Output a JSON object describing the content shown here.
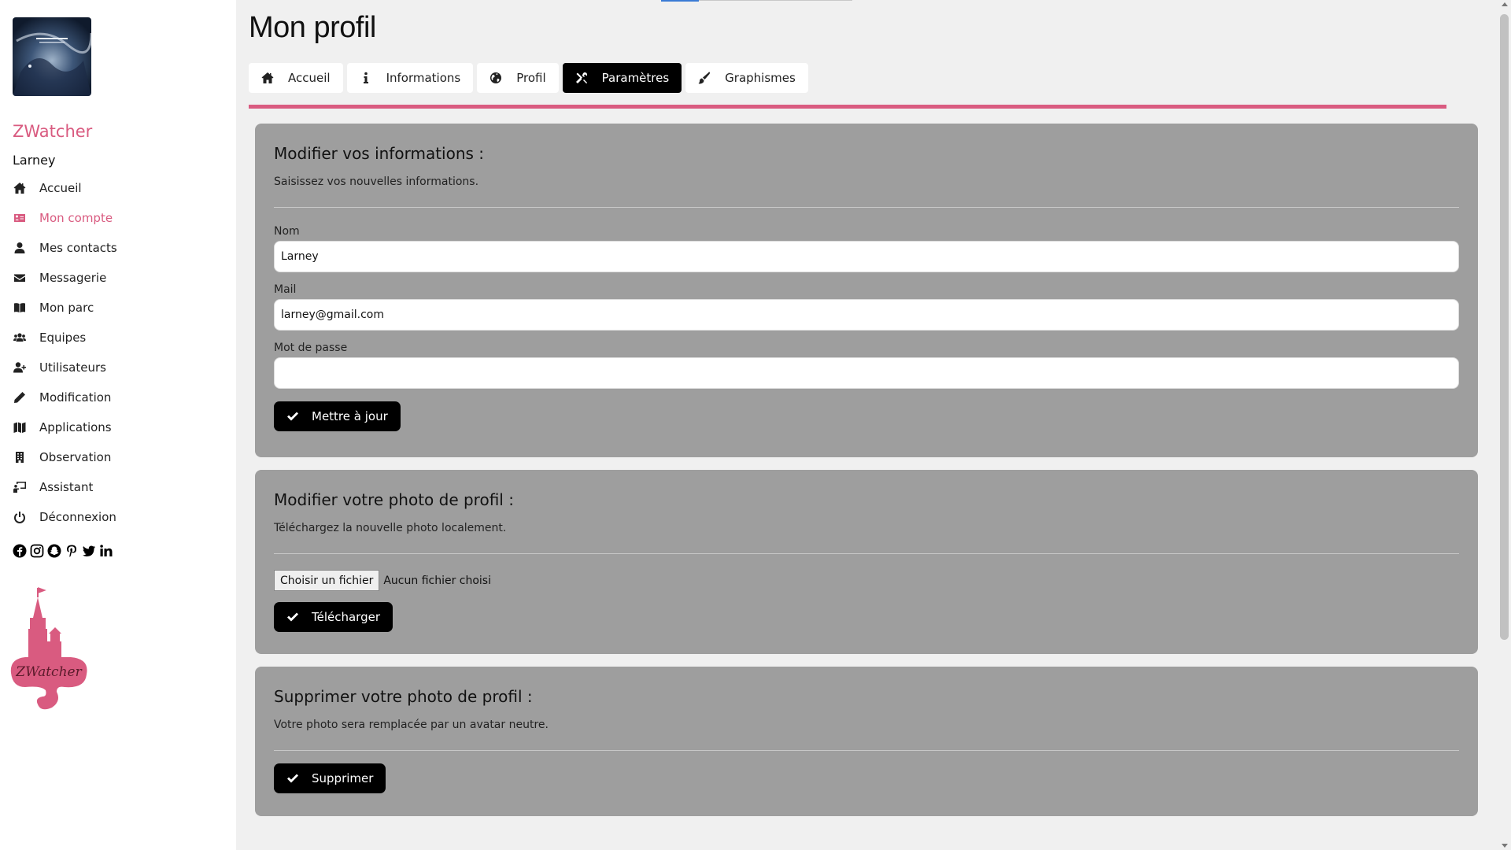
{
  "sidebar": {
    "brand": "ZWatcher",
    "username": "Larney",
    "items": [
      {
        "label": "Accueil",
        "icon": "home-icon"
      },
      {
        "label": "Mon compte",
        "icon": "id-card-icon",
        "active": true
      },
      {
        "label": "Mes contacts",
        "icon": "user-icon"
      },
      {
        "label": "Messagerie",
        "icon": "envelope-icon"
      },
      {
        "label": "Mon parc",
        "icon": "book-icon"
      },
      {
        "label": "Equipes",
        "icon": "users-icon"
      },
      {
        "label": "Utilisateurs",
        "icon": "user-plus-icon"
      },
      {
        "label": "Modification",
        "icon": "pencil-icon"
      },
      {
        "label": "Applications",
        "icon": "map-icon"
      },
      {
        "label": "Observation",
        "icon": "building-icon"
      },
      {
        "label": "Assistant",
        "icon": "chalkboard-user-icon"
      },
      {
        "label": "Déconnexion",
        "icon": "power-icon"
      }
    ],
    "social": [
      "facebook-icon",
      "instagram-icon",
      "snapchat-icon",
      "pinterest-icon",
      "twitter-icon",
      "linkedin-icon"
    ],
    "logo_text": "ZWatcher",
    "accent_color": "#d95b80"
  },
  "header": {
    "title": "Mon profil",
    "tabs": [
      {
        "label": "Accueil",
        "icon": "home-icon"
      },
      {
        "label": "Informations",
        "icon": "info-icon"
      },
      {
        "label": "Profil",
        "icon": "globe-icon"
      },
      {
        "label": "Paramètres",
        "icon": "tools-icon",
        "active": true
      },
      {
        "label": "Graphismes",
        "icon": "brush-icon"
      }
    ]
  },
  "info_card": {
    "title": "Modifier vos informations :",
    "subtitle": "Saisissez vos nouvelles informations.",
    "name_label": "Nom",
    "name_value": "Larney",
    "mail_label": "Mail",
    "mail_value": "larney@gmail.com",
    "password_label": "Mot de passe",
    "password_value": "",
    "submit_label": "Mettre à jour"
  },
  "photo_card": {
    "title": "Modifier votre photo de profil :",
    "subtitle": "Téléchargez la nouvelle photo localement.",
    "file_button": "Choisir un fichier",
    "file_status": "Aucun fichier choisi",
    "submit_label": "Télécharger"
  },
  "delete_card": {
    "title": "Supprimer votre photo de profil :",
    "subtitle": "Votre photo sera remplacée par un avatar neutre.",
    "submit_label": "Supprimer"
  }
}
